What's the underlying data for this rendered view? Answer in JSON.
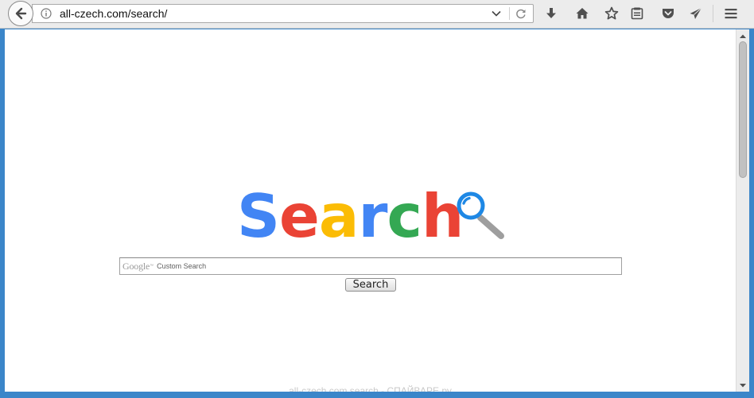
{
  "browser": {
    "url": "all-czech.com/search/",
    "icons": [
      "back-arrow-icon",
      "info-icon",
      "dropdown-arrow-icon",
      "reload-icon",
      "download-icon",
      "home-icon",
      "bookmark-star-icon",
      "reading-list-icon",
      "pocket-icon",
      "share-icon",
      "menu-hamburger-icon"
    ]
  },
  "page": {
    "logo": {
      "letters": [
        "S",
        "e",
        "a",
        "r",
        "c",
        "h"
      ],
      "colors": [
        "#4285F4",
        "#EA4335",
        "#FBBC05",
        "#4285F4",
        "#34A853",
        "#EA4335"
      ],
      "magnifier_color": "#1E88E5",
      "magnifier_handle_color": "#9E9E9E"
    },
    "search": {
      "watermark_brand": "Google",
      "watermark_tm": "™",
      "watermark_text": "Custom Search",
      "input_value": "",
      "button_label": "Search"
    },
    "footer_caption": "all-czech.com search - СПАЙВАРЕ.ру"
  },
  "scrollbar": {
    "position": 0
  },
  "colors": {
    "window_frame": "#3b86c9",
    "toolbar": "#ececec"
  }
}
